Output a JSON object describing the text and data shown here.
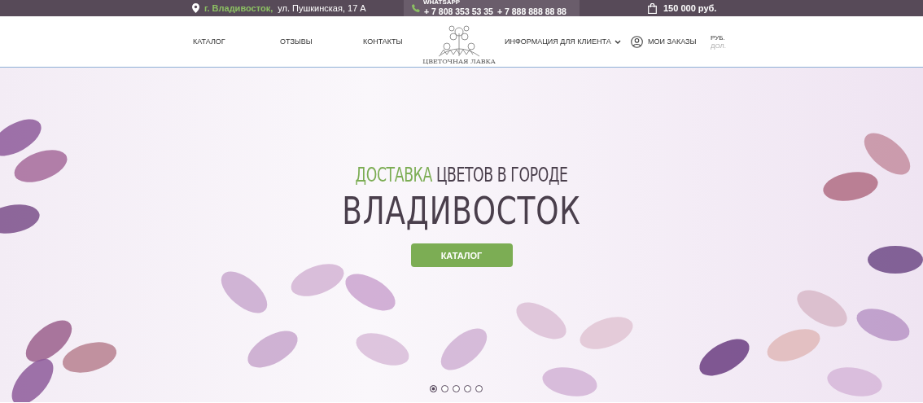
{
  "top_bar": {
    "city": "г. Владивосток,",
    "address": "ул. Пушкинская, 17 А",
    "whatsapp_label": "WHATSAPP",
    "phones": [
      "+ 7 808 353 53 35",
      "+ 7 888 888 88 88"
    ],
    "cart_total": "150 000 руб."
  },
  "nav": {
    "left_items": [
      "КАТАЛОГ",
      "ОТЗЫВЫ",
      "КОНТАКТЫ"
    ],
    "logo_text": "ЦВЕТОЧНАЯ ЛАВКА",
    "info_menu": "ИНФОРМАЦИЯ ДЛЯ КЛИЕНТА",
    "orders": "МОИ ЗАКАЗЫ",
    "currencies": [
      {
        "label": "РУБ.",
        "selected": true
      },
      {
        "label": "ДОЛ.",
        "selected": false
      }
    ]
  },
  "hero": {
    "title_accent": "ДОСТАВКА",
    "title_rest": "ЦВЕТОВ В ГОРОДЕ",
    "city": "ВЛАДИВОСТОК",
    "button": "КАТАЛОГ",
    "slides": [
      {
        "selected": true
      },
      {
        "selected": false
      },
      {
        "selected": false
      },
      {
        "selected": false
      },
      {
        "selected": false
      }
    ]
  }
}
